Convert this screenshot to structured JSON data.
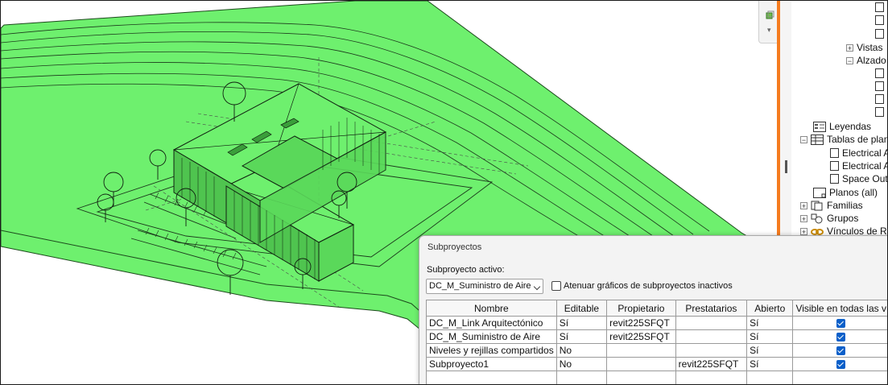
{
  "project_browser": {
    "items": [
      {
        "label": "Vistas",
        "expander": "+"
      },
      {
        "label": "Alzado",
        "expander": "−"
      },
      {
        "label": "Leyendas"
      },
      {
        "label": "Tablas de plani",
        "expander": "−"
      },
      {
        "label": "Electrical A"
      },
      {
        "label": "Electrical A"
      },
      {
        "label": "Space Outo"
      },
      {
        "label": "Planos (all)"
      },
      {
        "label": "Familias",
        "expander": "+"
      },
      {
        "label": "Grupos",
        "expander": "+"
      },
      {
        "label": "Vínculos de Re",
        "expander": "+"
      }
    ]
  },
  "worksets_dialog": {
    "title": "Subproyectos",
    "active_label": "Subproyecto activo:",
    "active_value": "DC_M_Suministro de Aire",
    "dim_label": "Atenuar gráficos de subproyectos inactivos",
    "columns": [
      "Nombre",
      "Editable",
      "Propietario",
      "Prestatarios",
      "Abierto",
      "Visible en todas las v"
    ],
    "rows": [
      {
        "name": "DC_M_Link Arquitectónico",
        "editable": "Sí",
        "owner": "revit225SFQT",
        "borrowers": "",
        "open": "Sí",
        "visible": true
      },
      {
        "name": "DC_M_Suministro de Aire",
        "editable": "Sí",
        "owner": "revit225SFQT",
        "borrowers": "",
        "open": "Sí",
        "visible": true
      },
      {
        "name": "Niveles y rejillas compartidos",
        "editable": "No",
        "owner": "",
        "borrowers": "",
        "open": "Sí",
        "visible": true
      },
      {
        "name": "Subproyecto1",
        "editable": "No",
        "owner": "",
        "borrowers": "revit225SFQT",
        "open": "Sí",
        "visible": true
      }
    ]
  },
  "colors": {
    "terrain": "#6ef06e",
    "splitter": "#f57c1f",
    "checkbox": "#0a5fc9"
  }
}
